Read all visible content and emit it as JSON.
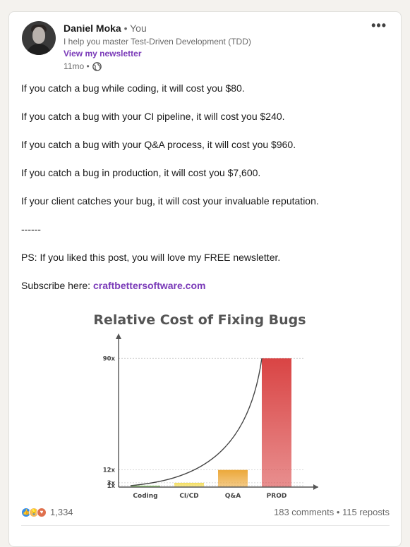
{
  "post": {
    "author_name": "Daniel Moka",
    "author_badge": "• You",
    "headline": "I help you master Test-Driven Development (TDD)",
    "newsletter_link": "View my newsletter",
    "time_ago": "11mo •",
    "more_menu": "•••",
    "body": [
      "If you catch a bug while coding, it will cost you $80.",
      "If you catch a bug with your CI pipeline, it will cost you $240.",
      "If you catch a bug with your Q&A process, it will cost you $960.",
      "If you catch a bug in production, it will cost you $7,600.",
      "If your client catches your bug, it will cost your invaluable reputation.",
      "------",
      "PS: If you liked this post, you will love my FREE newsletter."
    ],
    "subscribe_prefix": "Subscribe here: ",
    "subscribe_link": "craftbettersoftware.com"
  },
  "chart_data": {
    "type": "bar",
    "title": "Relative Cost of Fixing Bugs",
    "categories": [
      "Coding",
      "CI/CD",
      "Q&A",
      "PROD"
    ],
    "values": [
      1,
      3,
      12,
      90
    ],
    "yticks": [
      "1x",
      "3x",
      "12x",
      "90x"
    ],
    "ytick_values": [
      1,
      3,
      12,
      90
    ],
    "ylim": [
      0,
      100
    ],
    "colors": [
      "#8fd36b",
      "#f3dc5c",
      "#eca83a",
      "#d94444"
    ],
    "trend_line": "exponential"
  },
  "social": {
    "reaction_count": "1,334",
    "comments": "183 comments",
    "separator": " • ",
    "reposts": "115 reposts"
  }
}
